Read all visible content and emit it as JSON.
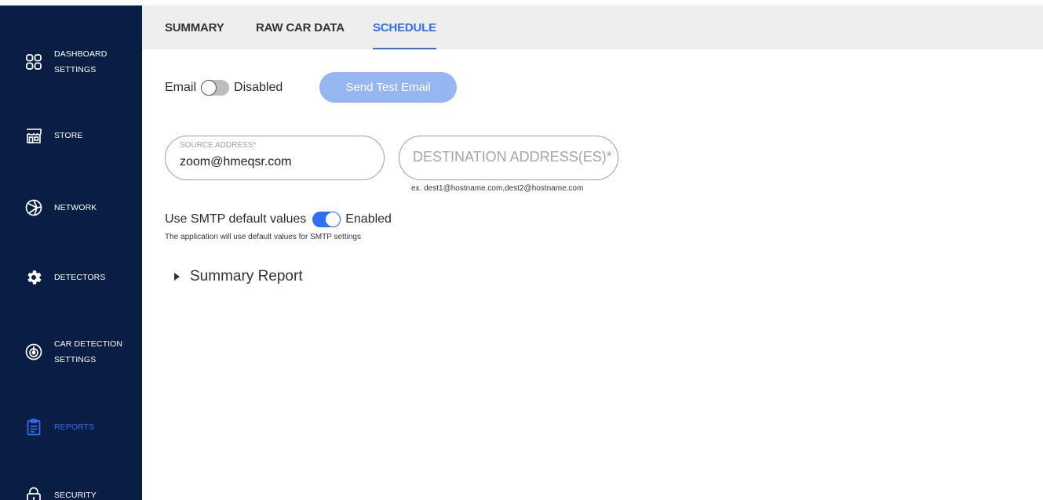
{
  "sidebar": {
    "items": [
      {
        "label1": "DASHBOARD",
        "label2": "SETTINGS",
        "icon": "dashboard-icon"
      },
      {
        "label1": "STORE",
        "label2": "",
        "icon": "store-icon"
      },
      {
        "label1": "NETWORK",
        "label2": "",
        "icon": "network-icon"
      },
      {
        "label1": "DETECTORS",
        "label2": "",
        "icon": "gear-icon"
      },
      {
        "label1": "CAR DETECTION",
        "label2": "SETTINGS",
        "icon": "target-icon"
      },
      {
        "label1": "REPORTS",
        "label2": "",
        "icon": "clipboard-icon",
        "active": true
      },
      {
        "label1": "SECURITY",
        "label2": "",
        "icon": "lock-icon"
      }
    ]
  },
  "tabs": [
    {
      "label": "SUMMARY"
    },
    {
      "label": "RAW CAR DATA"
    },
    {
      "label": "SCHEDULE",
      "active": true
    }
  ],
  "email": {
    "label": "Email",
    "toggle_state": "Disabled",
    "enabled": false,
    "send_test_label": "Send Test Email"
  },
  "source": {
    "label": "SOURCE ADDRESS*",
    "value": "zoom@hmeqsr.com"
  },
  "destination": {
    "placeholder": "DESTINATION ADDRESS(ES)*",
    "hint": "ex. dest1@hostname.com,dest2@hostname.com"
  },
  "smtp": {
    "label": "Use SMTP default values",
    "toggle_state": "Enabled",
    "enabled": true,
    "description": "The application will use default values for SMTP settings"
  },
  "summary_report": {
    "label": "Summary Report"
  },
  "colors": {
    "sidebar_bg": "#0a1e44",
    "accent": "#2f6ff5",
    "button_disabled": "#95b6f0",
    "topbar_bg": "#eeeeee"
  }
}
